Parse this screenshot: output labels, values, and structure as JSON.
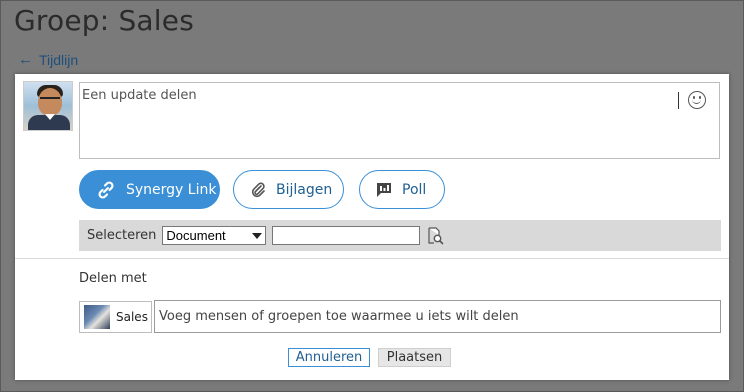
{
  "page": {
    "title": "Groep: Sales",
    "back_link": "Tijdlijn"
  },
  "composer": {
    "placeholder": "Een update delen",
    "emoji_icon": "smiley-icon"
  },
  "actions": {
    "link_label": "Synergy Link",
    "attach_label": "Bijlagen",
    "poll_label": "Poll"
  },
  "select_bar": {
    "label": "Selecteren",
    "document_type": "Document",
    "search_value": ""
  },
  "share": {
    "label": "Delen met",
    "chip_label": "Sales",
    "placeholder": "Voeg mensen of groepen toe waarmee u iets wilt delen"
  },
  "footer": {
    "cancel_label": "Annuleren",
    "post_label": "Plaatsen"
  },
  "colors": {
    "accent": "#3a8fd6",
    "backdrop": "#7a7a7a"
  }
}
